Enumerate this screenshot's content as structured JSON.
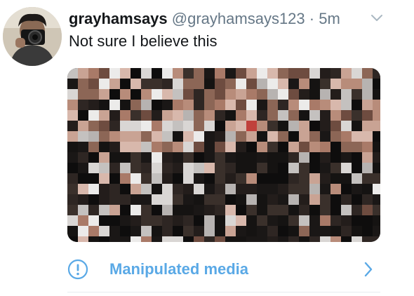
{
  "tweet": {
    "display_name": "grayhamsays",
    "handle": "@grayhamsays123",
    "separator": "·",
    "timestamp": "5m",
    "text": "Not sure I believe this"
  },
  "notice": {
    "label": "Manipulated media",
    "icon": "exclamation-circle-icon",
    "chevron": "chevron-right-icon"
  },
  "colors": {
    "link_blue": "#5aa9e6",
    "secondary_text": "#657786",
    "primary_text": "#14171a",
    "divider": "#e6ecf0"
  }
}
